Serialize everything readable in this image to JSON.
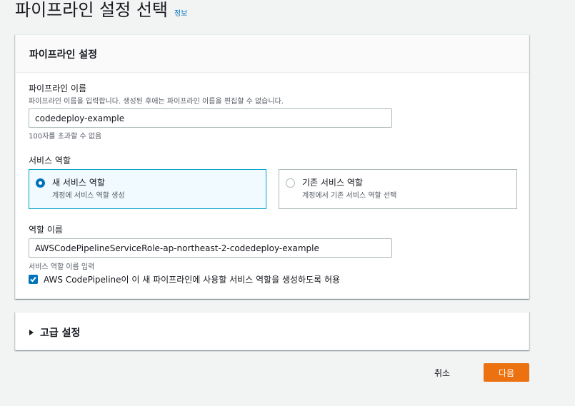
{
  "header": {
    "title": "파이프라인 설정 선택",
    "info_link": "정보"
  },
  "settings_panel": {
    "title": "파이프라인 설정",
    "pipeline_name": {
      "label": "파이프라인 이름",
      "description": "파이프라인 이름을 입력합니다. 생성된 후에는 파이프라인 이름을 편집할 수 없습니다.",
      "value": "codedeploy-example",
      "constraint": "100자를 초과할 수 없음"
    },
    "service_role": {
      "label": "서비스 역할",
      "options": [
        {
          "title": "새 서비스 역할",
          "subtitle": "계정에 서비스 역할 생성",
          "selected": true
        },
        {
          "title": "기존 서비스 역할",
          "subtitle": "계정에서 기존 서비스 역할 선택",
          "selected": false
        }
      ]
    },
    "role_name": {
      "label": "역할 이름",
      "value": "AWSCodePipelineServiceRole-ap-northeast-2-codedeploy-example",
      "hint": "서비스 역할 이름 입력"
    },
    "allow_checkbox": {
      "label": "AWS CodePipeline이 이 새 파이프라인에 사용할 서비스 역할을 생성하도록 허용",
      "checked": true
    }
  },
  "advanced_panel": {
    "title": "고급 설정"
  },
  "footer": {
    "cancel_label": "취소",
    "next_label": "다음"
  },
  "colors": {
    "accent": "#0073bb",
    "primary_button": "#ec7211",
    "selected_tile_border": "#00a1c9"
  }
}
